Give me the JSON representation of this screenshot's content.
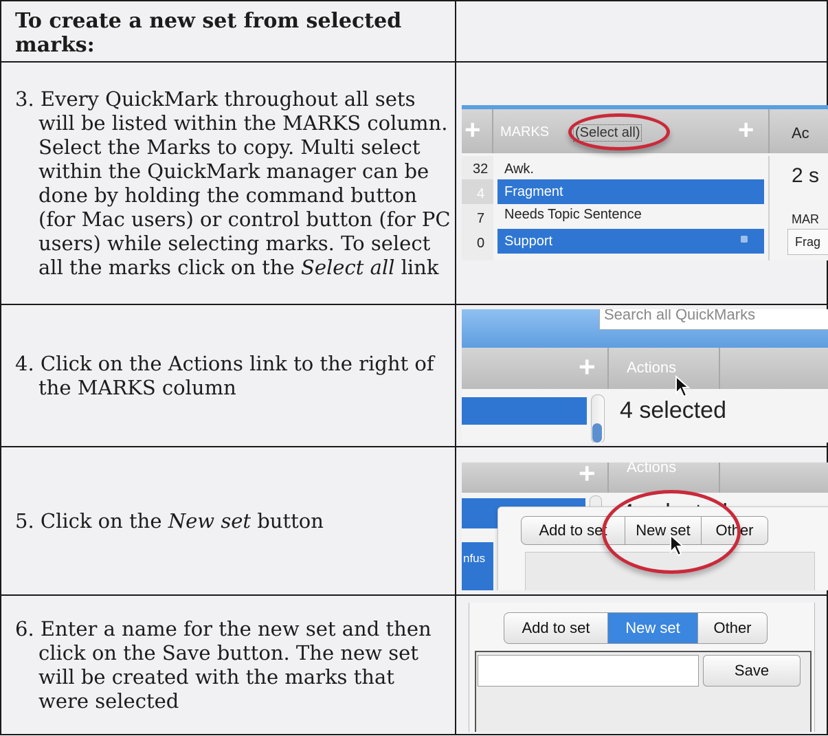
{
  "header": {
    "title": "To create a new set from selected marks:"
  },
  "steps": [
    {
      "num": "3.",
      "text_parts": [
        "Every QuickMark throughout all sets will be listed within the MARKS column. Select the Marks to copy. Multi select within the QuickMark manager can be done by holding the command button (for Mac users) or control button (for PC users) while selecting marks. To select all the marks click on the ",
        "Select all",
        " link"
      ]
    },
    {
      "num": "4.",
      "text": "Click on the Actions link to the right of the MARKS column"
    },
    {
      "num": "5.",
      "text_parts": [
        "Click on the ",
        "New set",
        " button"
      ]
    },
    {
      "num": "6.",
      "text": "Enter a name for the new set and then click on the Save button. The new set will be created with the marks that were selected"
    }
  ],
  "shot3": {
    "col_header": "MARKS",
    "select_all": "(Select all)",
    "actions_partial": "Ac",
    "counts": [
      "32",
      "4",
      "7",
      "0"
    ],
    "marks": [
      {
        "label": "Awk.",
        "selected": false
      },
      {
        "label": "Fragment",
        "selected": true
      },
      {
        "label": "Needs Topic Sentence",
        "selected": false
      },
      {
        "label": "Support",
        "selected": true
      }
    ],
    "selected_partial": "2 s",
    "marks_partial": "MAR",
    "frag_partial": "Frag",
    "lock_icon": "lock-icon",
    "highlight_color": "#2f76d2",
    "circle_color": "#c92a3a"
  },
  "shot4": {
    "search_placeholder": "Search all QuickMarks",
    "actions": "Actions",
    "selected_text": "4 selected",
    "cursor_icon": "arrow-cursor-icon"
  },
  "shot5": {
    "actions": "Actions",
    "selected_partial": "4 selected",
    "buttons": [
      "Add to set",
      "New set",
      "Other"
    ],
    "side_text": "nfus"
  },
  "shot6": {
    "buttons": [
      "Add to set",
      "New set",
      "Other"
    ],
    "active_button": "New set",
    "name_value": "",
    "save": "Save"
  }
}
